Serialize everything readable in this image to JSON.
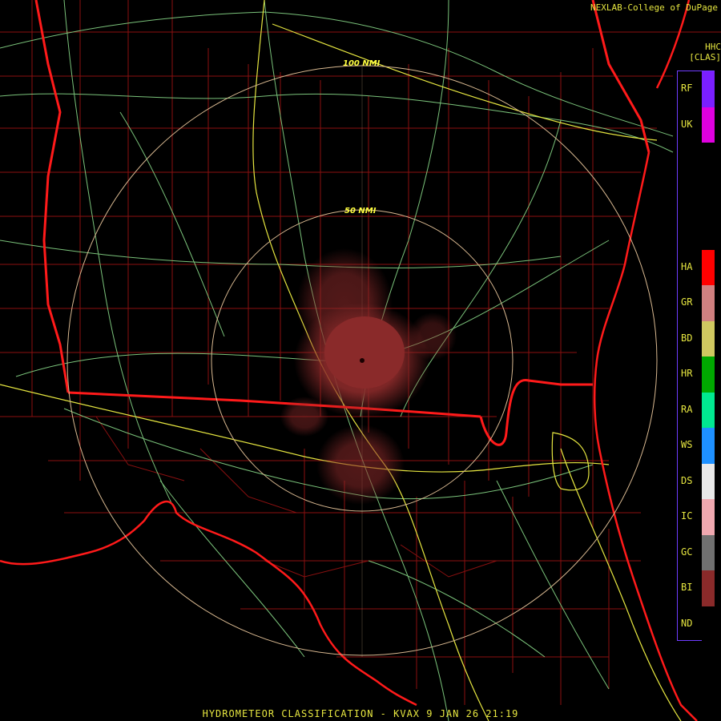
{
  "credit": "NEXLAB-College of DuPage",
  "legend": {
    "header_lines": [
      "HHC",
      "[CLAS]"
    ],
    "items": [
      {
        "code": "RF",
        "color": "#7a1fff"
      },
      {
        "code": "UK",
        "color": "#e000e0"
      },
      {
        "code": "",
        "color": "#000000"
      },
      {
        "code": "",
        "color": "#000000"
      },
      {
        "code": "",
        "color": "#000000"
      },
      {
        "code": "HA",
        "color": "#ff0000"
      },
      {
        "code": "GR",
        "color": "#d08080"
      },
      {
        "code": "BD",
        "color": "#d0c860"
      },
      {
        "code": "HR",
        "color": "#00a800"
      },
      {
        "code": "RA",
        "color": "#00e890"
      },
      {
        "code": "WS",
        "color": "#1e90ff"
      },
      {
        "code": "DS",
        "color": "#e8e8e8"
      },
      {
        "code": "IC",
        "color": "#f0a8b0"
      },
      {
        "code": "GC",
        "color": "#707070"
      },
      {
        "code": "BI",
        "color": "#8a2a2a"
      },
      {
        "code": "ND",
        "color": "#000000"
      }
    ]
  },
  "range_rings": [
    {
      "label": "50 NMI"
    },
    {
      "label": "100 NMI"
    }
  ],
  "footer": "HYDROMETEOR CLASSIFICATION - KVAX 9 JAN 26 21:19"
}
